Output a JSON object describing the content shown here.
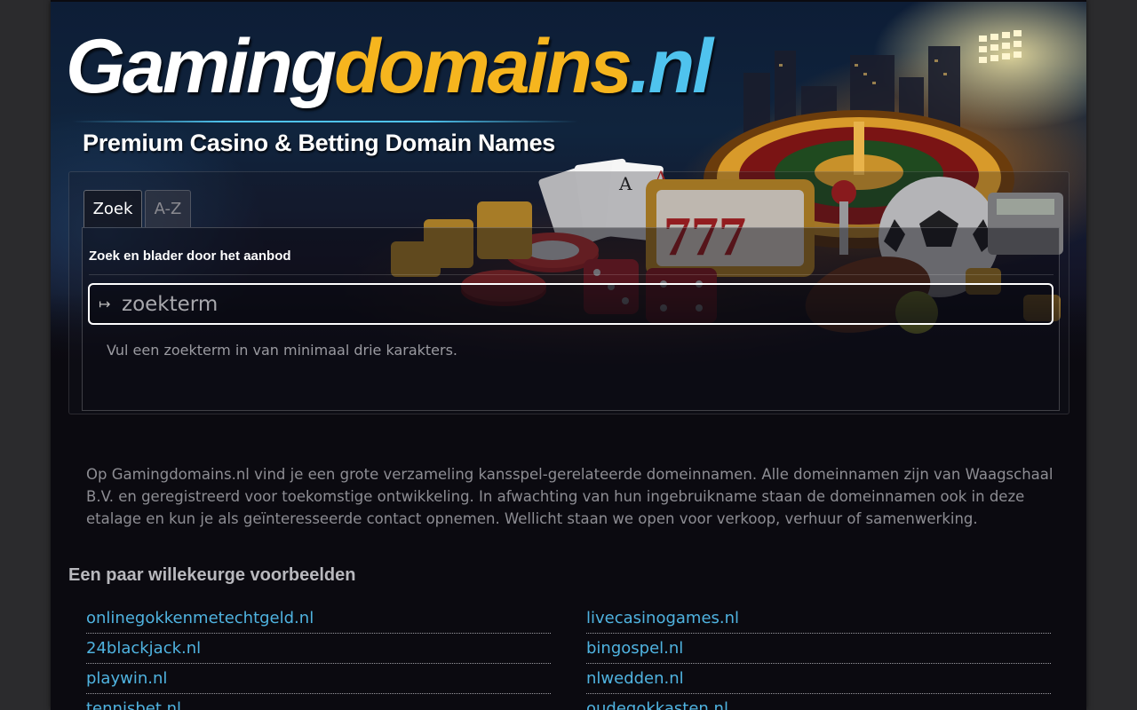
{
  "site": {
    "logo_part1": "Gaming",
    "logo_part2": "domains",
    "logo_part3": ".nl",
    "tagline": "Premium Casino & Betting Domain Names"
  },
  "tabs": [
    {
      "label": "Zoek",
      "active": true
    },
    {
      "label": "A-Z",
      "active": false
    }
  ],
  "search": {
    "heading": "Zoek en blader door het aanbod",
    "placeholder": "zoekterm",
    "value": "",
    "hint": "Vul een zoekterm in van minimaal drie karakters."
  },
  "intro": "Op Gamingdomains.nl vind je een grote verzameling kansspel-gerelateerde domeinnamen. Alle domeinnamen zijn van Waagschaal B.V. en geregistreerd voor toekomstige ontwikkeling. In afwachting van hun ingebruikname staan de domeinnamen ook in deze etalage en kun je als geïnteresseerde contact opnemen. Wellicht staan we open voor verkoop, verhuur of samenwerking.",
  "examples": {
    "title": "Een paar willekeurge voorbeelden",
    "left": [
      "onlinegokkenmetechtgeld.nl",
      "24blackjack.nl",
      "playwin.nl",
      "tennisbet.nl"
    ],
    "right": [
      "livecasinogames.nl",
      "bingospel.nl",
      "nlwedden.nl",
      "oudegokkasten.nl"
    ]
  },
  "colors": {
    "accent_gold": "#f6b51e",
    "accent_blue": "#4fc3ee",
    "link": "#4fb3e0",
    "background": "#0b0a10"
  }
}
